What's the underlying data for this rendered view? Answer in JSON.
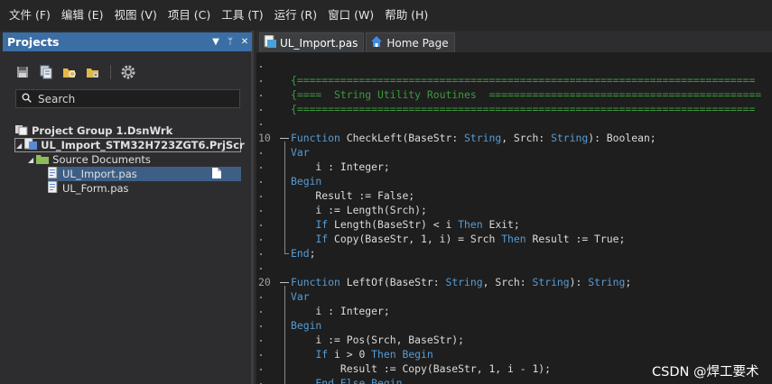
{
  "menu": [
    "文件 (F)",
    "编辑 (E)",
    "视图 (V)",
    "项目 (C)",
    "工具 (T)",
    "运行 (R)",
    "窗口 (W)",
    "帮助 (H)"
  ],
  "projects_panel": {
    "title": "Projects",
    "controls": [
      "▼",
      "ᛘ",
      "✕"
    ],
    "search_placeholder": "Search",
    "tree": {
      "group": "Project Group 1.DsnWrk",
      "project": "UL_Import_STM32H723ZGT6.PrjScr",
      "folder": "Source Documents",
      "files": [
        "UL_Import.pas",
        "UL_Form.pas"
      ]
    }
  },
  "tabs": [
    {
      "label": "UL_Import.pas",
      "icon": "pascal-file-icon",
      "active": true
    },
    {
      "label": "Home Page",
      "icon": "home-icon",
      "active": false
    }
  ],
  "editor": {
    "line_numbers": {
      "10": "10",
      "20": "20"
    },
    "lines": [
      [
        [
          "c-com",
          "{=========================================================================="
        ]
      ],
      [
        [
          "c-com",
          "{====  String Utility Routines  ============================================"
        ]
      ],
      [
        [
          "c-com",
          "{=========================================================================="
        ]
      ],
      [],
      [
        [
          "c-kw",
          "Function"
        ],
        [
          "c-id",
          " CheckLeft(BaseStr: "
        ],
        [
          "c-kw",
          "String"
        ],
        [
          "c-id",
          ", Srch: "
        ],
        [
          "c-kw",
          "String"
        ],
        [
          "c-id",
          "): Boolean;"
        ]
      ],
      [
        [
          "c-kw",
          "Var"
        ]
      ],
      [
        [
          "c-id",
          "    i : Integer;"
        ]
      ],
      [
        [
          "c-kw",
          "Begin"
        ]
      ],
      [
        [
          "c-id",
          "    Result := False;"
        ]
      ],
      [
        [
          "c-id",
          "    i := Length(Srch);"
        ]
      ],
      [
        [
          "c-id",
          "    "
        ],
        [
          "c-kw",
          "If"
        ],
        [
          "c-id",
          " Length(BaseStr) < i "
        ],
        [
          "c-kw",
          "Then"
        ],
        [
          "c-id",
          " Exit;"
        ]
      ],
      [
        [
          "c-id",
          "    "
        ],
        [
          "c-kw",
          "If"
        ],
        [
          "c-id",
          " Copy(BaseStr, 1, i) = Srch "
        ],
        [
          "c-kw",
          "Then"
        ],
        [
          "c-id",
          " Result := True;"
        ]
      ],
      [
        [
          "c-kw",
          "End"
        ],
        [
          "c-id",
          ";"
        ]
      ],
      [],
      [
        [
          "c-kw",
          "Function"
        ],
        [
          "c-id",
          " LeftOf(BaseStr: "
        ],
        [
          "c-kw",
          "String"
        ],
        [
          "c-id",
          ", Srch: "
        ],
        [
          "c-kw",
          "String"
        ],
        [
          "c-id",
          "): "
        ],
        [
          "c-kw",
          "String"
        ],
        [
          "c-id",
          ";"
        ]
      ],
      [
        [
          "c-kw",
          "Var"
        ]
      ],
      [
        [
          "c-id",
          "    i : Integer;"
        ]
      ],
      [
        [
          "c-kw",
          "Begin"
        ]
      ],
      [
        [
          "c-id",
          "    i := Pos(Srch, BaseStr);"
        ]
      ],
      [
        [
          "c-id",
          "    "
        ],
        [
          "c-kw",
          "If"
        ],
        [
          "c-id",
          " i > 0 "
        ],
        [
          "c-kw",
          "Then Begin"
        ]
      ],
      [
        [
          "c-id",
          "        Result := Copy(BaseStr, 1, i - 1);"
        ]
      ],
      [
        [
          "c-id",
          "    "
        ],
        [
          "c-kw",
          "End Else Begin"
        ]
      ]
    ]
  },
  "watermark": "CSDN @焊工要术",
  "colors": {
    "selection": "#3e5f85",
    "panel_header": "#3b6ea5",
    "comment": "#3c9a3c",
    "keyword": "#569cd6"
  }
}
